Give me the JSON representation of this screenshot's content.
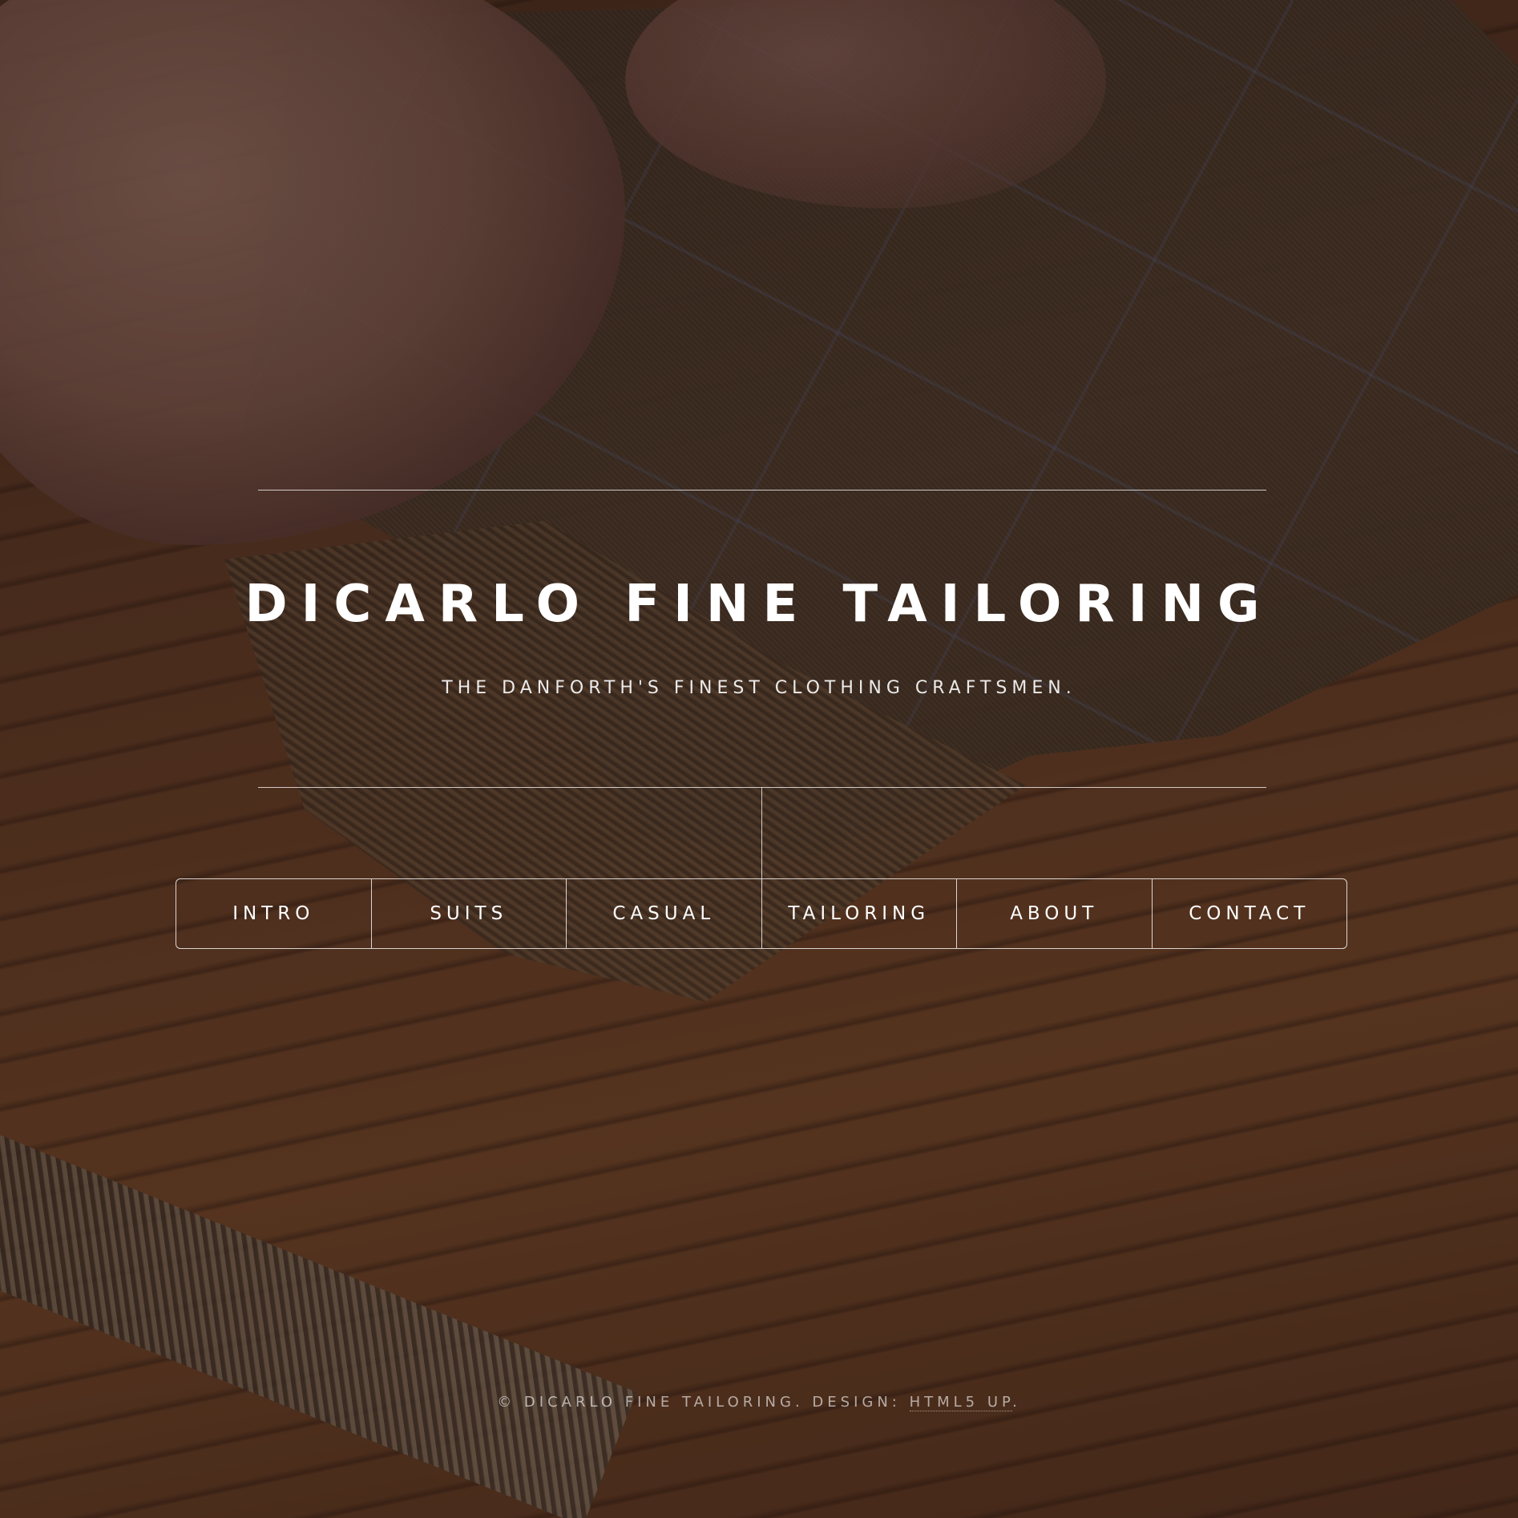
{
  "header": {
    "title": "DICARLO FINE TAILORING",
    "subtitle": "THE DANFORTH'S FINEST CLOTHING CRAFTSMEN."
  },
  "nav": {
    "items": [
      {
        "label": "INTRO"
      },
      {
        "label": "SUITS"
      },
      {
        "label": "CASUAL"
      },
      {
        "label": "TAILORING"
      },
      {
        "label": "ABOUT"
      },
      {
        "label": "CONTACT"
      }
    ]
  },
  "footer": {
    "copyright": "© DICARLO FINE TAILORING. DESIGN: ",
    "design_link": "HTML5 UP",
    "suffix": "."
  },
  "colors": {
    "text": "#ffffff",
    "overlay": "#140c0a"
  }
}
